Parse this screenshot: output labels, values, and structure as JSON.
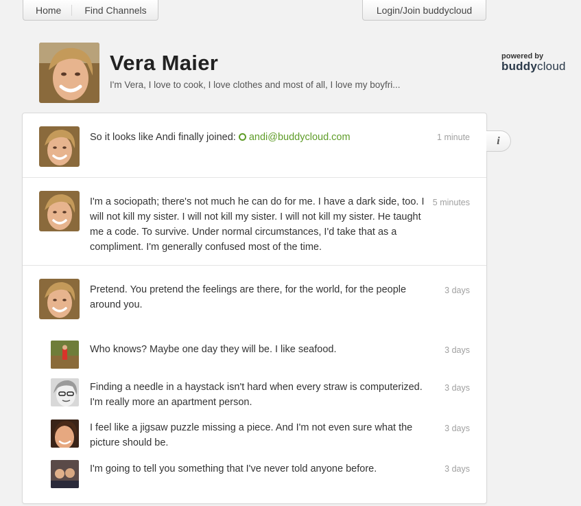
{
  "nav": {
    "home": "Home",
    "find_channels": "Find Channels",
    "login": "Login/Join buddycloud"
  },
  "powered": {
    "small": "powered by",
    "logo_bold": "buddy",
    "logo_light": "cloud"
  },
  "profile": {
    "name": "Vera Maier",
    "bio": "I'm Vera, I love to cook, I love clothes and most of all, I love my boyfri..."
  },
  "info_icon": "i",
  "posts": [
    {
      "text_before": "So it looks like Andi finally joined: ",
      "mention": "andi@buddycloud.com",
      "time": "1 minute"
    },
    {
      "text": "I'm a sociopath; there's not much he can do for me. I have a dark side, too. I will not kill my sister. I will not kill my sister. I will not kill my sister. He taught me a code. To survive. Under normal circumstances, I'd take that as a compliment. I'm generally confused most of the time.",
      "time": "5 minutes"
    },
    {
      "text": "Pretend. You pretend the feelings are there, for the world, for the people around you.",
      "time": "3 days",
      "replies": [
        {
          "text": "Who knows? Maybe one day they will be. I like seafood.",
          "time": "3 days"
        },
        {
          "text": "Finding a needle in a haystack isn't hard when every straw is computerized. I'm really more an apartment person.",
          "time": "3 days"
        },
        {
          "text": "I feel like a jigsaw puzzle missing a piece. And I'm not even sure what the picture should be.",
          "time": "3 days"
        },
        {
          "text": "I'm going to tell you something that I've never told anyone before.",
          "time": "3 days"
        }
      ]
    }
  ],
  "colors": {
    "mention": "#5e9c28",
    "background": "#f2f2f2",
    "timestamp": "#a0a0a0"
  }
}
